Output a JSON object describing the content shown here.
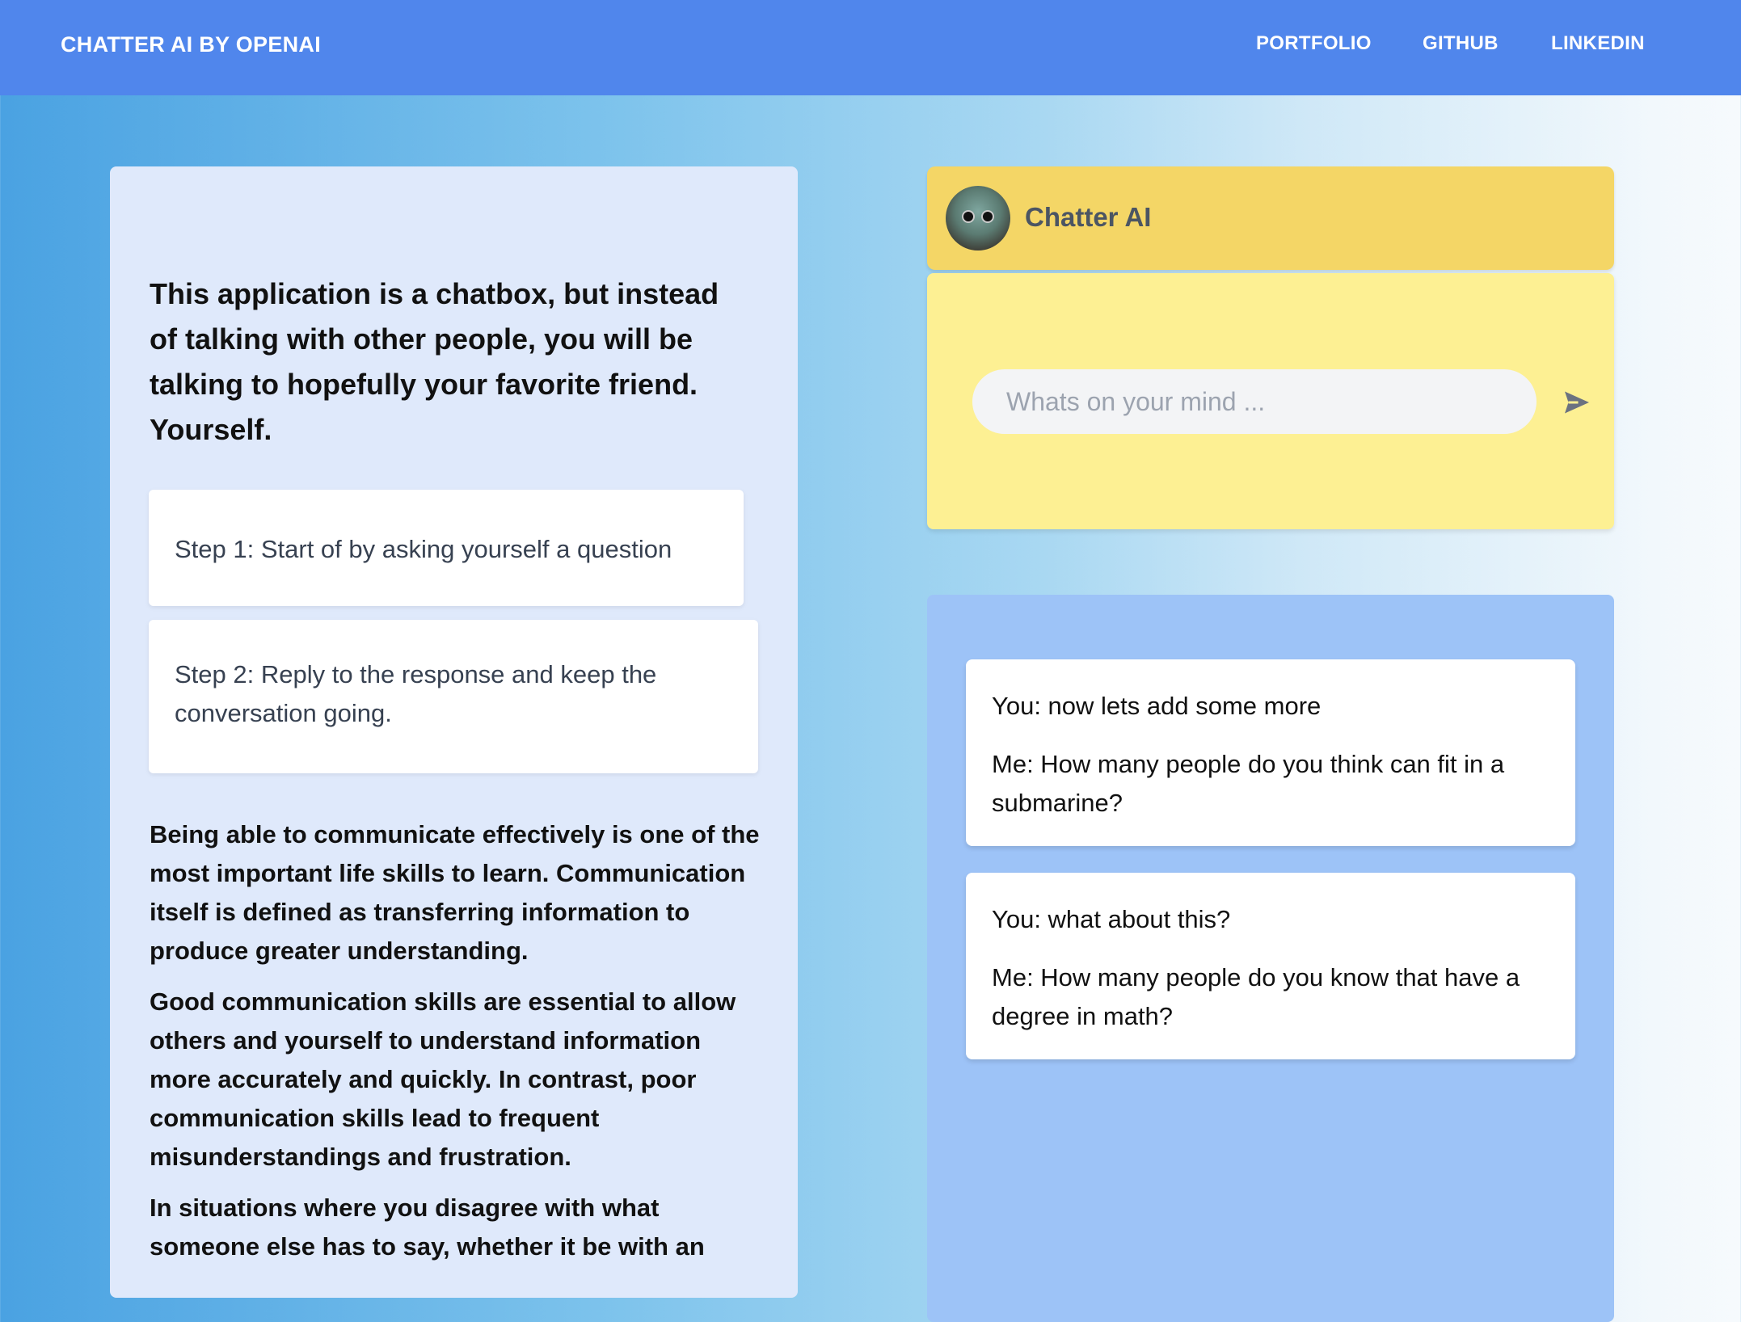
{
  "header": {
    "brand": "CHATTER AI BY OPENAI",
    "nav": [
      "PORTFOLIO",
      "GITHUB",
      "LINKEDIN"
    ]
  },
  "left": {
    "intro": "This application is a chatbox, but instead of talking with other people, you will be talking to hopefully your favorite friend. Yourself.",
    "steps": [
      "Step 1: Start of by asking yourself a question",
      "Step 2: Reply to the response and keep the conversation going."
    ],
    "paragraphs": [
      "Being able to communicate effectively is one of the most important life skills to learn. Communication itself is defined as transferring information to produce greater understanding.",
      "Good communication skills are essential to allow others and yourself to understand information more accurately and quickly. In contrast, poor communication skills lead to frequent misunderstandings and frustration.",
      "In situations where you disagree with what someone else has to say, whether it be with an"
    ]
  },
  "chat": {
    "title": "Chatter AI",
    "input_placeholder": "Whats on your mind ...",
    "input_value": "",
    "send_icon": "paper-plane-icon"
  },
  "messages": [
    {
      "you": "You: now lets add some more",
      "me": "Me: How many people do you think can fit in a submarine?"
    },
    {
      "you": "You: what about this?",
      "me": "Me: How many people do you know that have a degree in math?"
    }
  ],
  "colors": {
    "header": "#5086ec",
    "chat_header": "#f4d666",
    "input_panel": "#fdf093",
    "messages_panel": "#9dc3f7",
    "left_panel": "#dfe9fb"
  }
}
